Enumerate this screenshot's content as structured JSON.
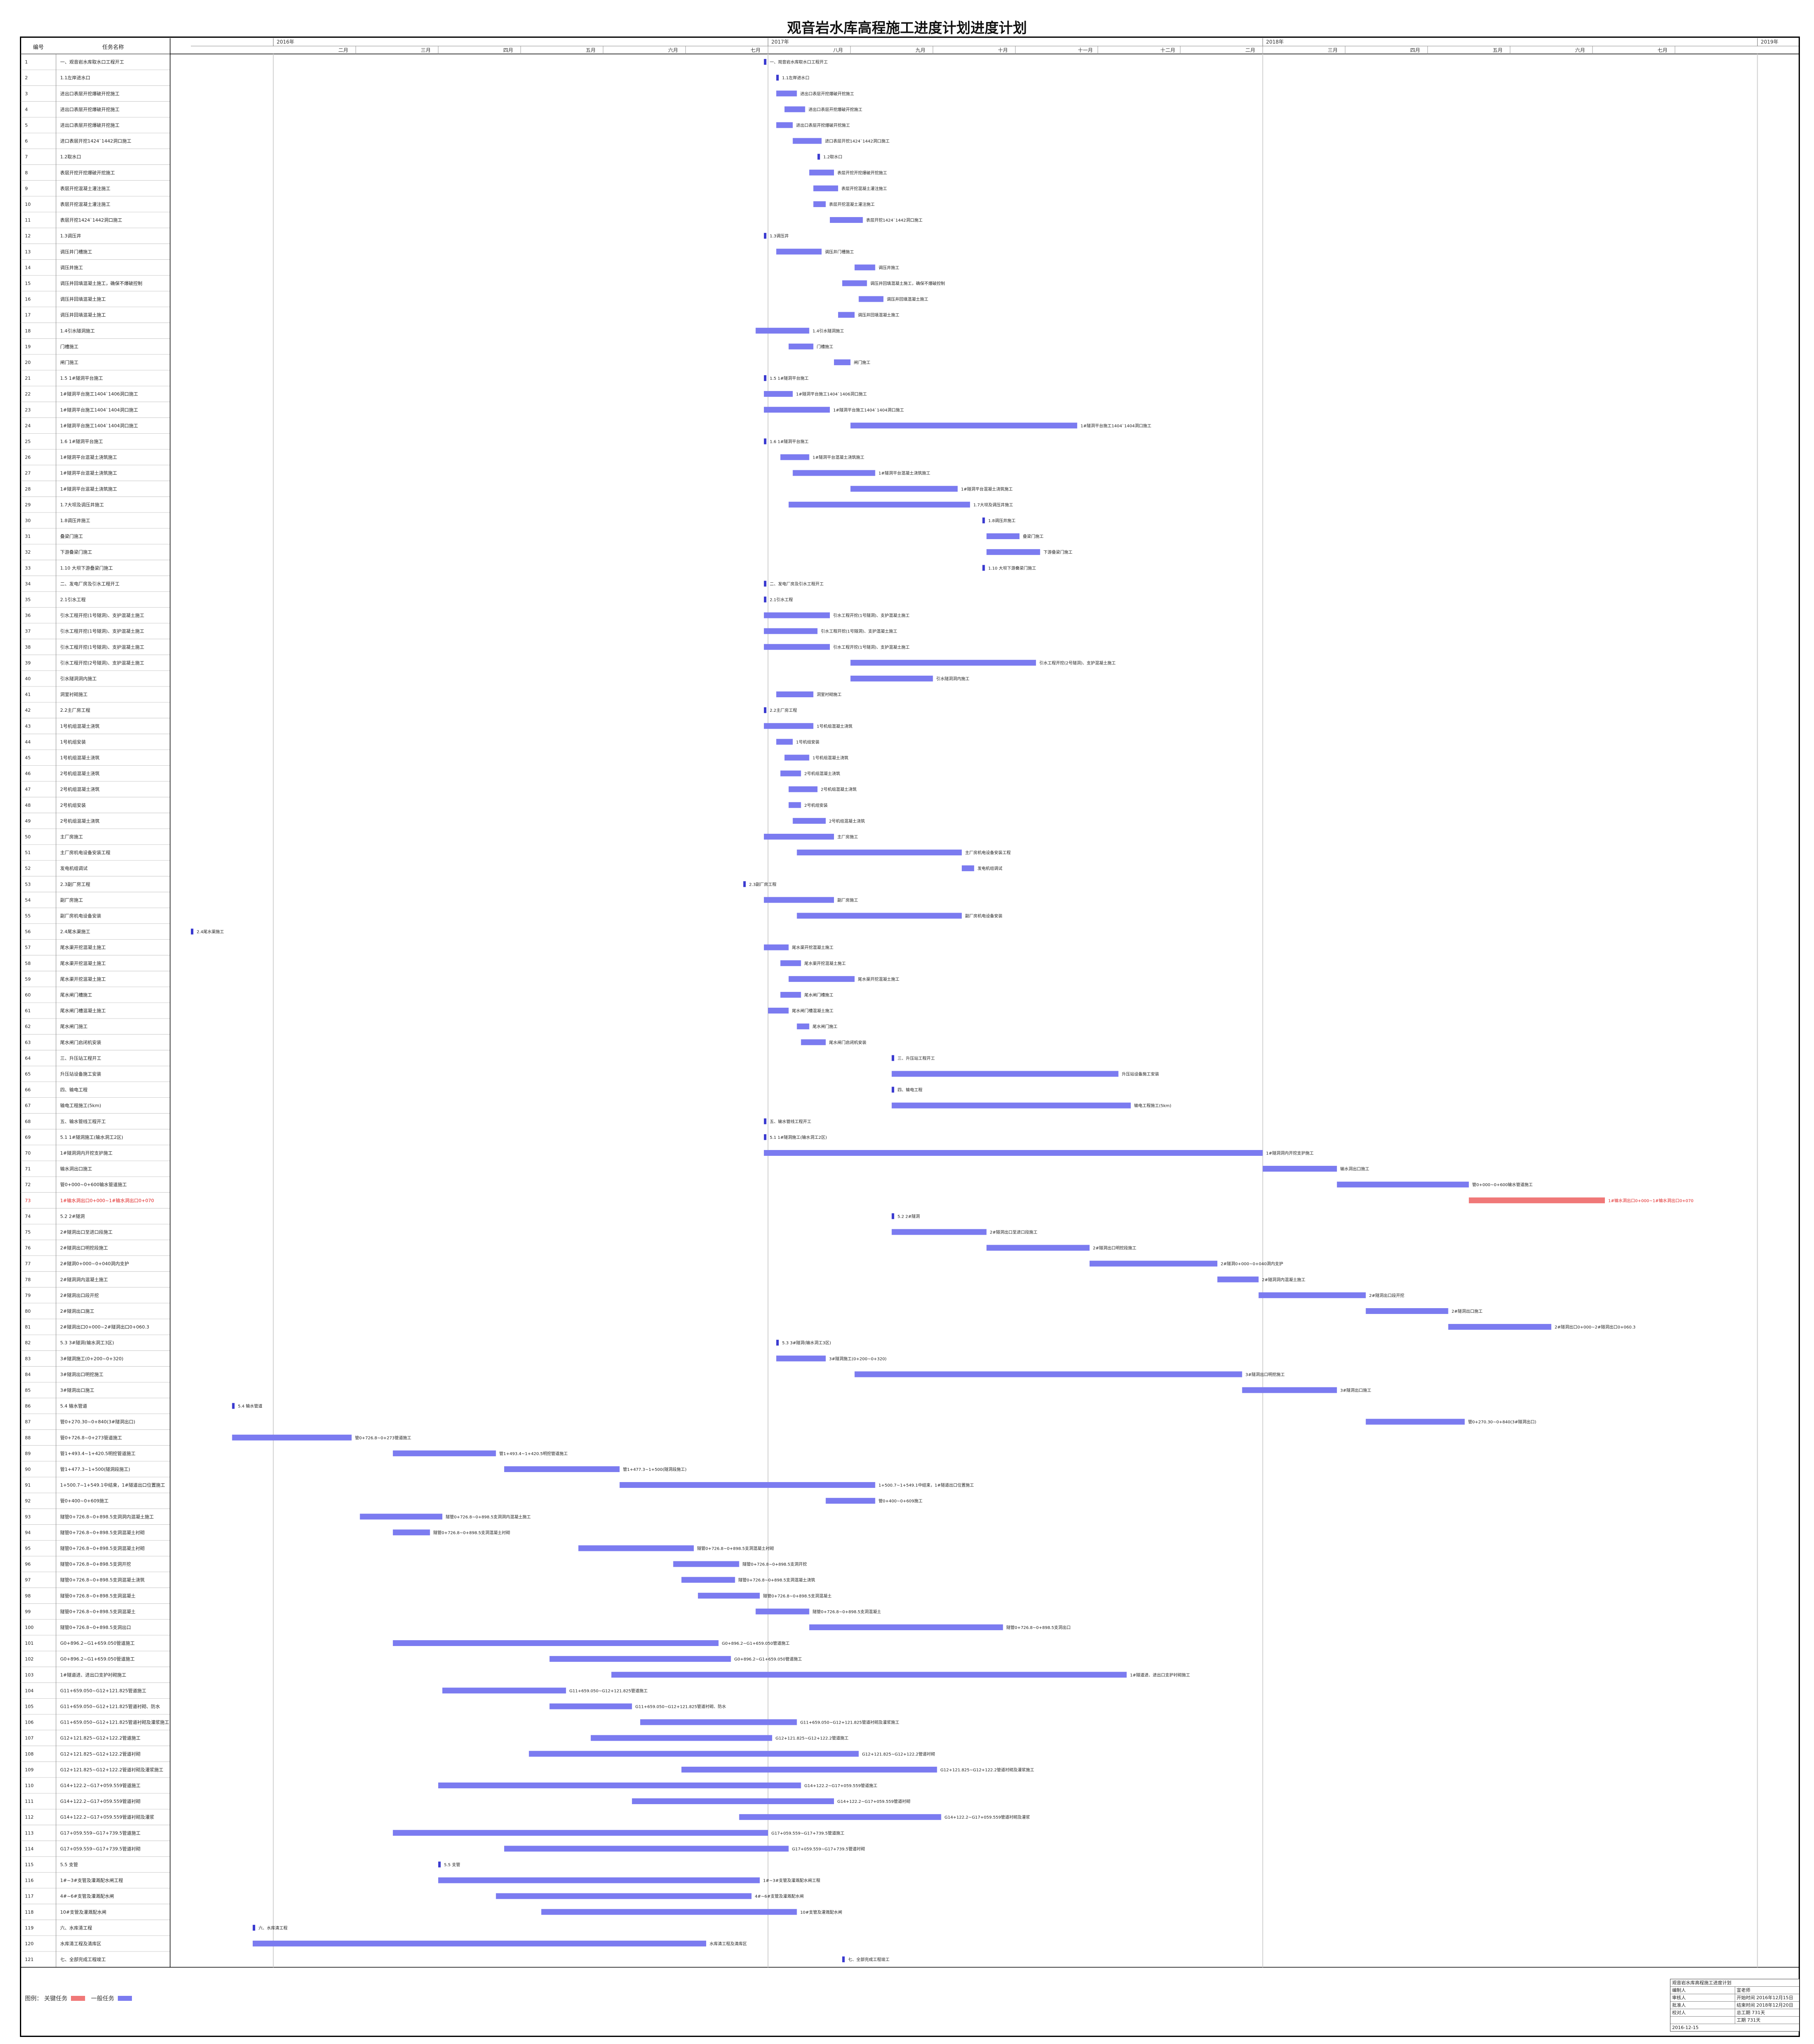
{
  "title": "观音岩水库高程施工进度计划进度计划",
  "header": {
    "col_no": "编号",
    "col_name": "任务名称"
  },
  "colors": {
    "bar": "#7b7bf0",
    "critical": "#f07878",
    "critical_text": "#e02020",
    "grid": "#d0d0d0"
  },
  "legend": {
    "label": "图例：",
    "critical": "关键任务",
    "normal": "一般任务"
  },
  "info_box": {
    "title": "观音岩水库高程施工进度计划",
    "rows": [
      [
        "编制人",
        "宣老师"
      ],
      [
        "审核人",
        "开始时间 2016年12月15日"
      ],
      [
        "批准人",
        "结束时间 2018年12月20日"
      ],
      [
        "校对人",
        "总工期 731天"
      ],
      [
        "",
        "工期 731天"
      ]
    ],
    "date": "2016-12-15"
  },
  "chart_data": {
    "type": "gantt",
    "time_axis": {
      "years": [
        "2016年",
        "2017年",
        "2018年",
        "2019年"
      ],
      "months": [
        "二月",
        "三月",
        "四月",
        "五月",
        "六月",
        "七月",
        "八月",
        "九月",
        "十月",
        "十一月",
        "十二月"
      ],
      "year_tick_months": [
        0,
        12,
        24,
        36
      ],
      "month_tick_months": [
        2,
        4,
        6,
        8,
        10,
        12,
        14,
        16,
        18,
        20,
        22,
        24,
        26,
        28,
        30,
        32,
        34
      ],
      "range_months": [
        -2,
        37
      ]
    },
    "rows": [
      {
        "no": "1",
        "name": "一、观音岩水库取水口工程开工",
        "start": 11.9,
        "end": 12.0,
        "mile": true
      },
      {
        "no": "2",
        "name": "1.1左岸进水口",
        "start": 12.2,
        "end": 12.3,
        "mile": true
      },
      {
        "no": "3",
        "name": "进出口表层开挖爆破开挖施工",
        "start": 12.2,
        "end": 12.7
      },
      {
        "no": "4",
        "name": "进出口表层开挖爆破开挖施工",
        "start": 12.4,
        "end": 12.9
      },
      {
        "no": "5",
        "name": "进出口表层开挖爆破开挖施工",
        "start": 12.2,
        "end": 12.6
      },
      {
        "no": "6",
        "name": "进口表层开挖1424`1442洞口施工",
        "start": 12.6,
        "end": 13.3
      },
      {
        "no": "7",
        "name": "1.2取水口",
        "start": 13.2,
        "end": 13.3,
        "mile": true
      },
      {
        "no": "8",
        "name": "表层开挖开挖爆破开挖施工",
        "start": 13.0,
        "end": 13.6
      },
      {
        "no": "9",
        "name": "表层开挖混凝土灌注施工",
        "start": 13.1,
        "end": 13.7
      },
      {
        "no": "10",
        "name": "表层开挖混凝土灌注施工",
        "start": 13.1,
        "end": 13.4
      },
      {
        "no": "11",
        "name": "表层开挖1424`1442洞口施工",
        "start": 13.5,
        "end": 14.3
      },
      {
        "no": "12",
        "name": "1.3调压井",
        "start": 11.9,
        "end": 12.0,
        "mile": true
      },
      {
        "no": "13",
        "name": "调压井门槽施工",
        "start": 12.2,
        "end": 13.3
      },
      {
        "no": "14",
        "name": "调压井施工",
        "start": 14.1,
        "end": 14.6
      },
      {
        "no": "15",
        "name": "调压井回填混凝土施工，确保不爆破控制",
        "start": 13.8,
        "end": 14.4
      },
      {
        "no": "16",
        "name": "调压井回填混凝土施工",
        "start": 14.2,
        "end": 14.8
      },
      {
        "no": "17",
        "name": "调压井回填混凝土施工",
        "start": 13.7,
        "end": 14.1
      },
      {
        "no": "18",
        "name": "1.4引水隧洞施工",
        "start": 11.7,
        "end": 13.0
      },
      {
        "no": "19",
        "name": "门槽施工",
        "start": 12.5,
        "end": 13.1
      },
      {
        "no": "20",
        "name": "闸门施工",
        "start": 13.6,
        "end": 14.0
      },
      {
        "no": "21",
        "name": "1.5 1#隧洞平台施工",
        "start": 11.9,
        "end": 12.0,
        "mile": true
      },
      {
        "no": "22",
        "name": "1#隧洞平台施工1404`1406洞口施工",
        "start": 11.9,
        "end": 12.6
      },
      {
        "no": "23",
        "name": "1#隧洞平台施工1404`1404洞口施工",
        "start": 11.9,
        "end": 13.5
      },
      {
        "no": "24",
        "name": "1#隧洞平台施工1404`1404洞口施工",
        "start": 14.0,
        "end": 19.5
      },
      {
        "no": "25",
        "name": "1.6 1#隧洞平台施工",
        "start": 11.9,
        "end": 12.0,
        "mile": true
      },
      {
        "no": "26",
        "name": "1#隧洞平台混凝土浇筑施工",
        "start": 12.3,
        "end": 13.0
      },
      {
        "no": "27",
        "name": "1#隧洞平台混凝土浇筑施工",
        "start": 12.6,
        "end": 14.6
      },
      {
        "no": "28",
        "name": "1#隧洞平台混凝土浇筑施工",
        "start": 14.0,
        "end": 16.6
      },
      {
        "no": "29",
        "name": "1.7大坝及调压井施工",
        "start": 12.5,
        "end": 16.9
      },
      {
        "no": "30",
        "name": "1.8调压井施工",
        "start": 17.2,
        "end": 17.3,
        "mile": true
      },
      {
        "no": "31",
        "name": "叠梁门施工",
        "start": 17.3,
        "end": 18.1
      },
      {
        "no": "32",
        "name": "下游叠梁门施工",
        "start": 17.3,
        "end": 18.6
      },
      {
        "no": "33",
        "name": "1.10 大坝下游叠梁门施工",
        "start": 17.2,
        "end": 17.3,
        "mile": true
      },
      {
        "no": "34",
        "name": "二、发电厂房及引水工程开工",
        "start": 11.9,
        "end": 12.0,
        "mile": true
      },
      {
        "no": "35",
        "name": "2.1引水工程",
        "start": 11.9,
        "end": 12.0,
        "mile": true
      },
      {
        "no": "36",
        "name": "引水工程开挖(1号隧洞)、支护混凝土施工",
        "start": 11.9,
        "end": 13.5
      },
      {
        "no": "37",
        "name": "引水工程开挖(1号隧洞)、支护混凝土施工",
        "start": 11.9,
        "end": 13.2
      },
      {
        "no": "38",
        "name": "引水工程开挖(1号隧洞)、支护混凝土施工",
        "start": 11.9,
        "end": 13.5
      },
      {
        "no": "39",
        "name": "引水工程开挖(2号隧洞)、支护混凝土施工",
        "start": 14.0,
        "end": 18.5
      },
      {
        "no": "40",
        "name": "引水隧洞洞内施工",
        "start": 14.0,
        "end": 16.0
      },
      {
        "no": "41",
        "name": "洞室衬砌施工",
        "start": 12.2,
        "end": 13.1
      },
      {
        "no": "42",
        "name": "2.2主厂房工程",
        "start": 11.9,
        "end": 12.0,
        "mile": true
      },
      {
        "no": "43",
        "name": "1号机组混凝土浇筑",
        "start": 11.9,
        "end": 13.1
      },
      {
        "no": "44",
        "name": "1号机组安装",
        "start": 12.2,
        "end": 12.6
      },
      {
        "no": "45",
        "name": "1号机组混凝土浇筑",
        "start": 12.4,
        "end": 13.0
      },
      {
        "no": "46",
        "name": "2号机组混凝土浇筑",
        "start": 12.3,
        "end": 12.8
      },
      {
        "no": "47",
        "name": "2号机组混凝土浇筑",
        "start": 12.5,
        "end": 13.2
      },
      {
        "no": "48",
        "name": "2号机组安装",
        "start": 12.5,
        "end": 12.8
      },
      {
        "no": "49",
        "name": "2号机组混凝土浇筑",
        "start": 12.6,
        "end": 13.4
      },
      {
        "no": "50",
        "name": "主厂房施工",
        "start": 11.9,
        "end": 13.6
      },
      {
        "no": "51",
        "name": "主厂房机电设备安装工程",
        "start": 12.7,
        "end": 16.7
      },
      {
        "no": "52",
        "name": "发电机组调试",
        "start": 16.7,
        "end": 17.0
      },
      {
        "no": "53",
        "name": "2.3副厂房工程",
        "start": 11.4,
        "end": 11.5,
        "mile": true
      },
      {
        "no": "54",
        "name": "副厂房施工",
        "start": 11.9,
        "end": 13.6
      },
      {
        "no": "55",
        "name": "副厂房机电设备安装",
        "start": 12.7,
        "end": 16.7
      },
      {
        "no": "56",
        "name": "2.4尾水渠施工",
        "start": -2.0,
        "end": -1.9,
        "mile": true
      },
      {
        "no": "57",
        "name": "尾水渠开挖混凝土施工",
        "start": 11.9,
        "end": 12.5
      },
      {
        "no": "58",
        "name": "尾水渠开挖混凝土施工",
        "start": 12.3,
        "end": 12.8
      },
      {
        "no": "59",
        "name": "尾水渠开挖混凝土施工",
        "start": 12.5,
        "end": 14.1
      },
      {
        "no": "60",
        "name": "尾水闸门槽施工",
        "start": 12.3,
        "end": 12.8
      },
      {
        "no": "61",
        "name": "尾水闸门槽混凝土施工",
        "start": 12.0,
        "end": 12.5
      },
      {
        "no": "62",
        "name": "尾水闸门施工",
        "start": 12.7,
        "end": 13.0
      },
      {
        "no": "63",
        "name": "尾水闸门启闭机安装",
        "start": 12.8,
        "end": 13.4
      },
      {
        "no": "64",
        "name": "三、升压站工程开工",
        "start": 15.0,
        "end": 15.1,
        "mile": true
      },
      {
        "no": "65",
        "name": "升压站设备施工安装",
        "start": 15.0,
        "end": 20.5
      },
      {
        "no": "66",
        "name": "四、输电工程",
        "start": 15.0,
        "end": 15.1,
        "mile": true
      },
      {
        "no": "67",
        "name": "输电工程施工(5km)",
        "start": 15.0,
        "end": 20.8
      },
      {
        "no": "68",
        "name": "五、输水管线工程开工",
        "start": 11.9,
        "end": 12.0,
        "mile": true
      },
      {
        "no": "69",
        "name": "5.1 1#隧洞施工(输水洞工2区)",
        "start": 11.9,
        "end": 12.0,
        "mile": true
      },
      {
        "no": "70",
        "name": "1#隧洞洞内开挖支护施工",
        "start": 11.9,
        "end": 24.0
      },
      {
        "no": "71",
        "name": "输水洞出口施工",
        "start": 24.0,
        "end": 25.8
      },
      {
        "no": "72",
        "name": "管0+000~0+600输水管道施工",
        "start": 25.8,
        "end": 29.0
      },
      {
        "no": "73",
        "name": "1#输水洞出口0+000~1#输水洞出口0+070",
        "start": 29.0,
        "end": 32.3,
        "critical": true
      },
      {
        "no": "74",
        "name": "5.2 2#隧洞",
        "start": 15.0,
        "end": 15.1,
        "mile": true
      },
      {
        "no": "75",
        "name": "2#隧洞出口至进口段施工",
        "start": 15.0,
        "end": 17.3
      },
      {
        "no": "76",
        "name": "2#隧洞出口明挖段施工",
        "start": 17.3,
        "end": 19.8
      },
      {
        "no": "77",
        "name": "2#隧洞0+000~0+040洞内支护",
        "start": 19.8,
        "end": 22.9
      },
      {
        "no": "78",
        "name": "2#隧洞洞内混凝土施工",
        "start": 22.9,
        "end": 23.9
      },
      {
        "no": "79",
        "name": "2#隧洞出口段开挖",
        "start": 23.9,
        "end": 26.5
      },
      {
        "no": "80",
        "name": "2#隧洞出口施工",
        "start": 26.5,
        "end": 28.5
      },
      {
        "no": "81",
        "name": "2#隧洞出口0+000~2#隧洞出口0+060.3",
        "start": 28.5,
        "end": 31.0
      },
      {
        "no": "82",
        "name": "5.3 3#隧洞(输水洞工3区)",
        "start": 12.2,
        "end": 12.3,
        "mile": true
      },
      {
        "no": "83",
        "name": "3#隧洞施工(0+200~0+320)",
        "start": 12.2,
        "end": 13.4
      },
      {
        "no": "84",
        "name": "3#隧洞出口明挖施工",
        "start": 14.1,
        "end": 23.5
      },
      {
        "no": "85",
        "name": "3#隧洞出口施工",
        "start": 23.5,
        "end": 25.8
      },
      {
        "no": "86",
        "name": "5.4 输水管道",
        "start": -1.0,
        "end": -0.9,
        "mile": true
      },
      {
        "no": "87",
        "name": "管0+270.30~0+840(3#隧洞出口)",
        "start": 26.5,
        "end": 28.9
      },
      {
        "no": "88",
        "name": "管0+726.8~0+273管道施工",
        "start": -1.0,
        "end": 1.9
      },
      {
        "no": "89",
        "name": "管1+493.4~1+420.5明挖管道施工",
        "start": 2.9,
        "end": 5.4
      },
      {
        "no": "90",
        "name": "管1+477.3~1+500(隧洞段施工)",
        "start": 5.6,
        "end": 8.4
      },
      {
        "no": "91",
        "name": "1+500.7~1+549.1中结束，1#隧道出口位置施工",
        "start": 8.4,
        "end": 14.6
      },
      {
        "no": "92",
        "name": "管0+400~0+609施工",
        "start": 13.4,
        "end": 14.6
      },
      {
        "no": "93",
        "name": "隧管0+726.8~0+898.5支洞洞内混凝土施工",
        "start": 2.1,
        "end": 4.1
      },
      {
        "no": "94",
        "name": "隧管0+726.8~0+898.5支洞混凝土衬砌",
        "start": 2.9,
        "end": 3.8
      },
      {
        "no": "95",
        "name": "隧管0+726.8~0+898.5支洞混凝土衬砌",
        "start": 7.4,
        "end": 10.2
      },
      {
        "no": "96",
        "name": "隧管0+726.8~0+898.5支洞开挖",
        "start": 9.7,
        "end": 11.3
      },
      {
        "no": "97",
        "name": "隧管0+726.8~0+898.5支洞混凝土浇筑",
        "start": 9.9,
        "end": 11.2
      },
      {
        "no": "98",
        "name": "隧管0+726.8~0+898.5支洞混凝土",
        "start": 10.3,
        "end": 11.8
      },
      {
        "no": "99",
        "name": "隧管0+726.8~0+898.5支洞混凝土",
        "start": 11.7,
        "end": 13.0
      },
      {
        "no": "100",
        "name": "隧管0+726.8~0+898.5支洞出口",
        "start": 13.0,
        "end": 17.7
      },
      {
        "no": "101",
        "name": "G0+896.2~G1+659.050管道施工",
        "start": 2.9,
        "end": 10.8
      },
      {
        "no": "102",
        "name": "G0+896.2~G1+659.050管道施工",
        "start": 6.7,
        "end": 11.1
      },
      {
        "no": "103",
        "name": "1#隧道进、进出口支护衬砌施工",
        "start": 8.2,
        "end": 20.7
      },
      {
        "no": "104",
        "name": "G11+659.050~G12+121.825管道施工",
        "start": 4.1,
        "end": 7.1
      },
      {
        "no": "105",
        "name": "G11+659.050~G12+121.825管道衬砌、防水",
        "start": 6.7,
        "end": 8.7
      },
      {
        "no": "106",
        "name": "G11+659.050~G12+121.825管道衬砌及灌浆施工",
        "start": 8.9,
        "end": 12.7
      },
      {
        "no": "107",
        "name": "G12+121.825~G12+122.2管道施工",
        "start": 7.7,
        "end": 12.1
      },
      {
        "no": "108",
        "name": "G12+121.825~G12+122.2管道衬砌",
        "start": 6.2,
        "end": 14.2
      },
      {
        "no": "109",
        "name": "G12+121.825~G12+122.2管道衬砌及灌浆施工",
        "start": 9.9,
        "end": 16.1
      },
      {
        "no": "110",
        "name": "G14+122.2~G17+059.559管道施工",
        "start": 4.0,
        "end": 12.8
      },
      {
        "no": "111",
        "name": "G14+122.2~G17+059.559管道衬砌",
        "start": 8.7,
        "end": 13.6
      },
      {
        "no": "112",
        "name": "G14+122.2~G17+059.559管道衬砌及灌浆",
        "start": 11.3,
        "end": 16.2
      },
      {
        "no": "113",
        "name": "G17+059.559~G17+739.5管道施工",
        "start": 2.9,
        "end": 12.0
      },
      {
        "no": "114",
        "name": "G17+059.559~G17+739.5管道衬砌",
        "start": 5.6,
        "end": 12.5
      },
      {
        "no": "115",
        "name": "5.5 支管",
        "start": 4.0,
        "end": 4.1,
        "mile": true
      },
      {
        "no": "116",
        "name": "1#~3#支管及灌溉配水闸工程",
        "start": 4.0,
        "end": 11.8
      },
      {
        "no": "117",
        "name": "4#~6#支管及灌溉配水闸",
        "start": 5.4,
        "end": 11.6
      },
      {
        "no": "118",
        "name": "10#支管及灌溉配水闸",
        "start": 6.5,
        "end": 12.7
      },
      {
        "no": "119",
        "name": "六、水库清工程",
        "start": -0.5,
        "end": -0.4,
        "mile": true
      },
      {
        "no": "120",
        "name": "水库清工程及清库区",
        "start": -0.5,
        "end": 10.5
      },
      {
        "no": "121",
        "name": "七、全部完成工程竣工",
        "start": 13.8,
        "end": 13.9,
        "mile": true
      }
    ]
  }
}
